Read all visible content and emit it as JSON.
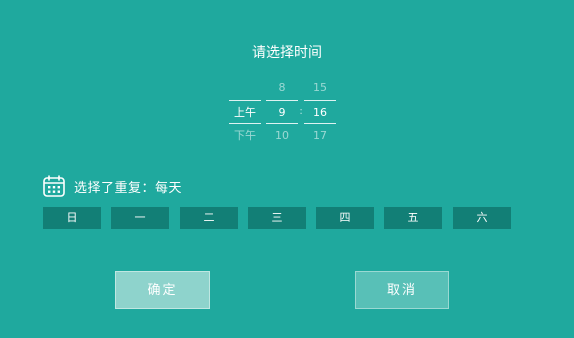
{
  "title": "请选择时间",
  "picker": {
    "ampm": {
      "prev": "",
      "selected": "上午",
      "next": "下午"
    },
    "hour": {
      "prev": "8",
      "selected": "9",
      "next": "10"
    },
    "minute": {
      "prev": "15",
      "selected": "16",
      "next": "17"
    }
  },
  "repeat": {
    "icon": "calendar-icon",
    "label": "选择了重复：每天"
  },
  "weekdays": [
    "日",
    "一",
    "二",
    "三",
    "四",
    "五",
    "六"
  ],
  "buttons": {
    "confirm": "确定",
    "cancel": "取消"
  },
  "colors": {
    "background": "#1fa99e",
    "day_button": "#127f76",
    "confirm_button": "#8ed3cc",
    "cancel_button": "#58c0b7"
  }
}
